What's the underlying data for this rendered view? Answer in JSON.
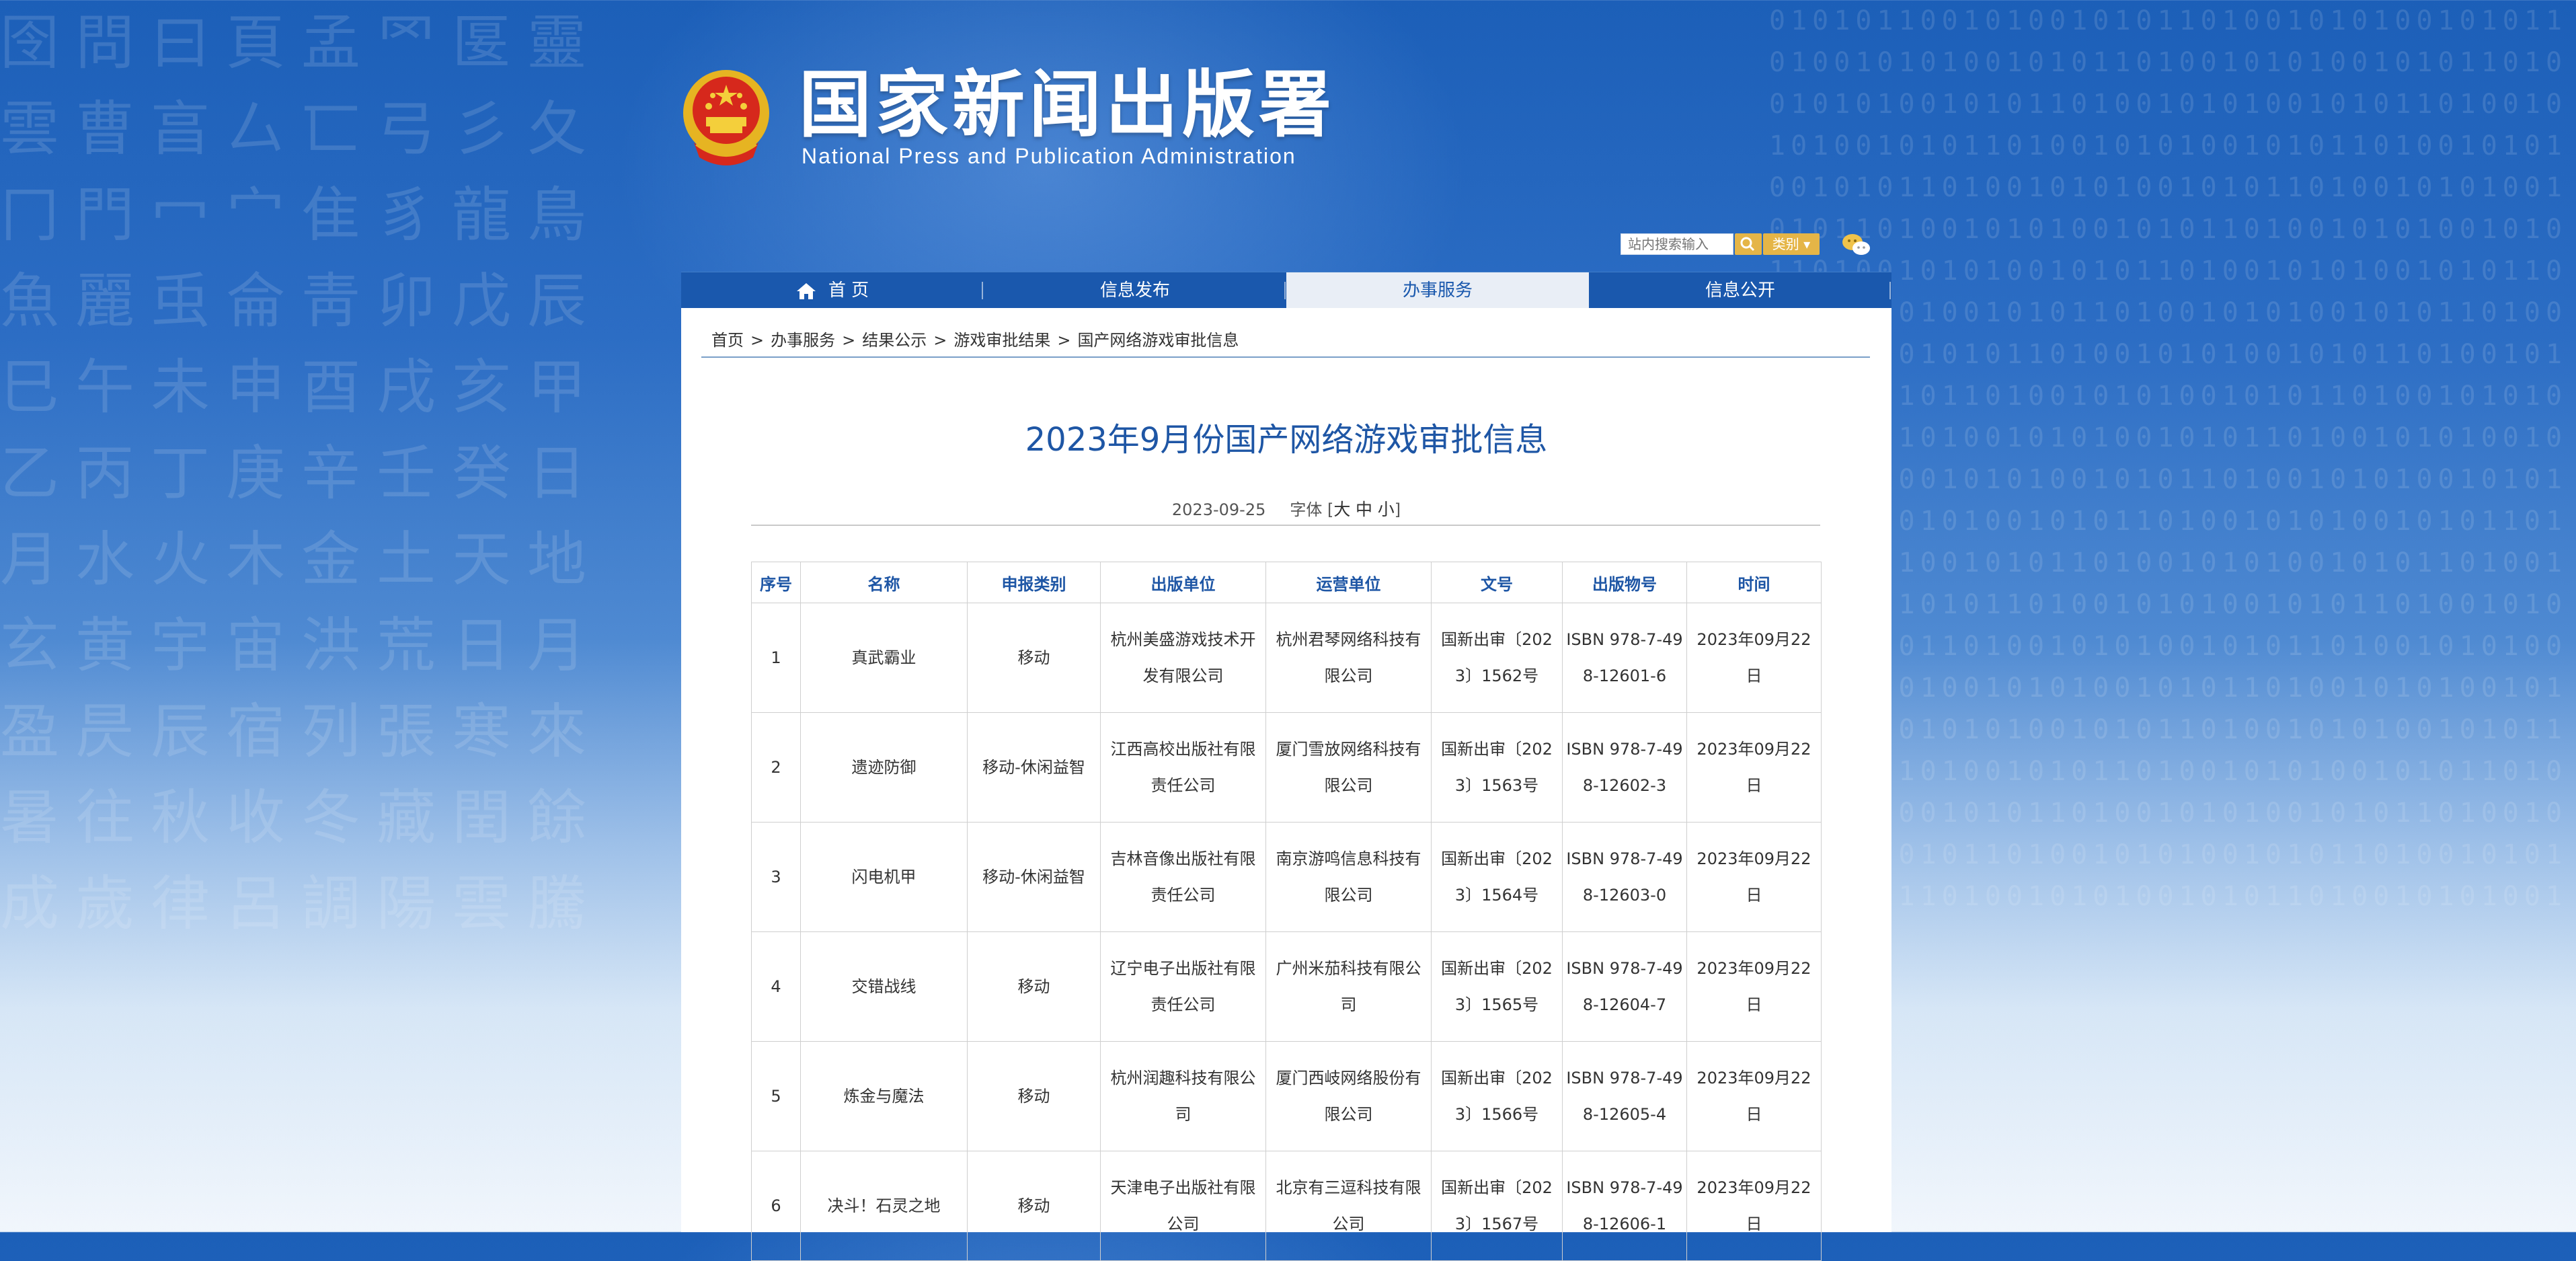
{
  "header": {
    "title": "国家新闻出版署",
    "subtitle": "National  Press and Publication Administration"
  },
  "search": {
    "placeholder": "站内搜索输入",
    "category_label": "类别 ▾"
  },
  "nav": {
    "items": [
      {
        "label": "首 页"
      },
      {
        "label": "信息发布"
      },
      {
        "label": "办事服务"
      },
      {
        "label": "信息公开"
      }
    ]
  },
  "breadcrumb": {
    "items": [
      "首页",
      "办事服务",
      "结果公示",
      "游戏审批结果",
      "国产网络游戏审批信息"
    ],
    "separator": ">"
  },
  "article": {
    "title": "2023年9月份国产网络游戏审批信息",
    "date": "2023-09-25",
    "font_label": "字体",
    "font_open": "[",
    "font_large": "大",
    "font_medium": "中",
    "font_small": "小",
    "font_close": "]"
  },
  "table": {
    "headers": [
      "序号",
      "名称",
      "申报类别",
      "出版单位",
      "运营单位",
      "文号",
      "出版物号",
      "时间"
    ],
    "rows": [
      [
        "1",
        "真武霸业",
        "移动",
        "杭州美盛游戏技术开发有限公司",
        "杭州君琴网络科技有限公司",
        "国新出审〔2023〕1562号",
        "ISBN 978-7-498-12601-6",
        "2023年09月22日"
      ],
      [
        "2",
        "遗迹防御",
        "移动-休闲益智",
        "江西高校出版社有限责任公司",
        "厦门雪放网络科技有限公司",
        "国新出审〔2023〕1563号",
        "ISBN 978-7-498-12602-3",
        "2023年09月22日"
      ],
      [
        "3",
        "闪电机甲",
        "移动-休闲益智",
        "吉林音像出版社有限责任公司",
        "南京游鸣信息科技有限公司",
        "国新出审〔2023〕1564号",
        "ISBN 978-7-498-12603-0",
        "2023年09月22日"
      ],
      [
        "4",
        "交错战线",
        "移动",
        "辽宁电子出版社有限责任公司",
        "广州米茄科技有限公司",
        "国新出审〔2023〕1565号",
        "ISBN 978-7-498-12604-7",
        "2023年09月22日"
      ],
      [
        "5",
        "炼金与魔法",
        "移动",
        "杭州润趣科技有限公司",
        "厦门西岐网络股份有限公司",
        "国新出审〔2023〕1566号",
        "ISBN 978-7-498-12605-4",
        "2023年09月22日"
      ],
      [
        "6",
        "决斗！石灵之地",
        "移动",
        "天津电子出版社有限公司",
        "北京有三逗科技有限公司",
        "国新出审〔2023〕1567号",
        "ISBN 978-7-498-12606-1",
        "2023年09月22日"
      ]
    ]
  }
}
